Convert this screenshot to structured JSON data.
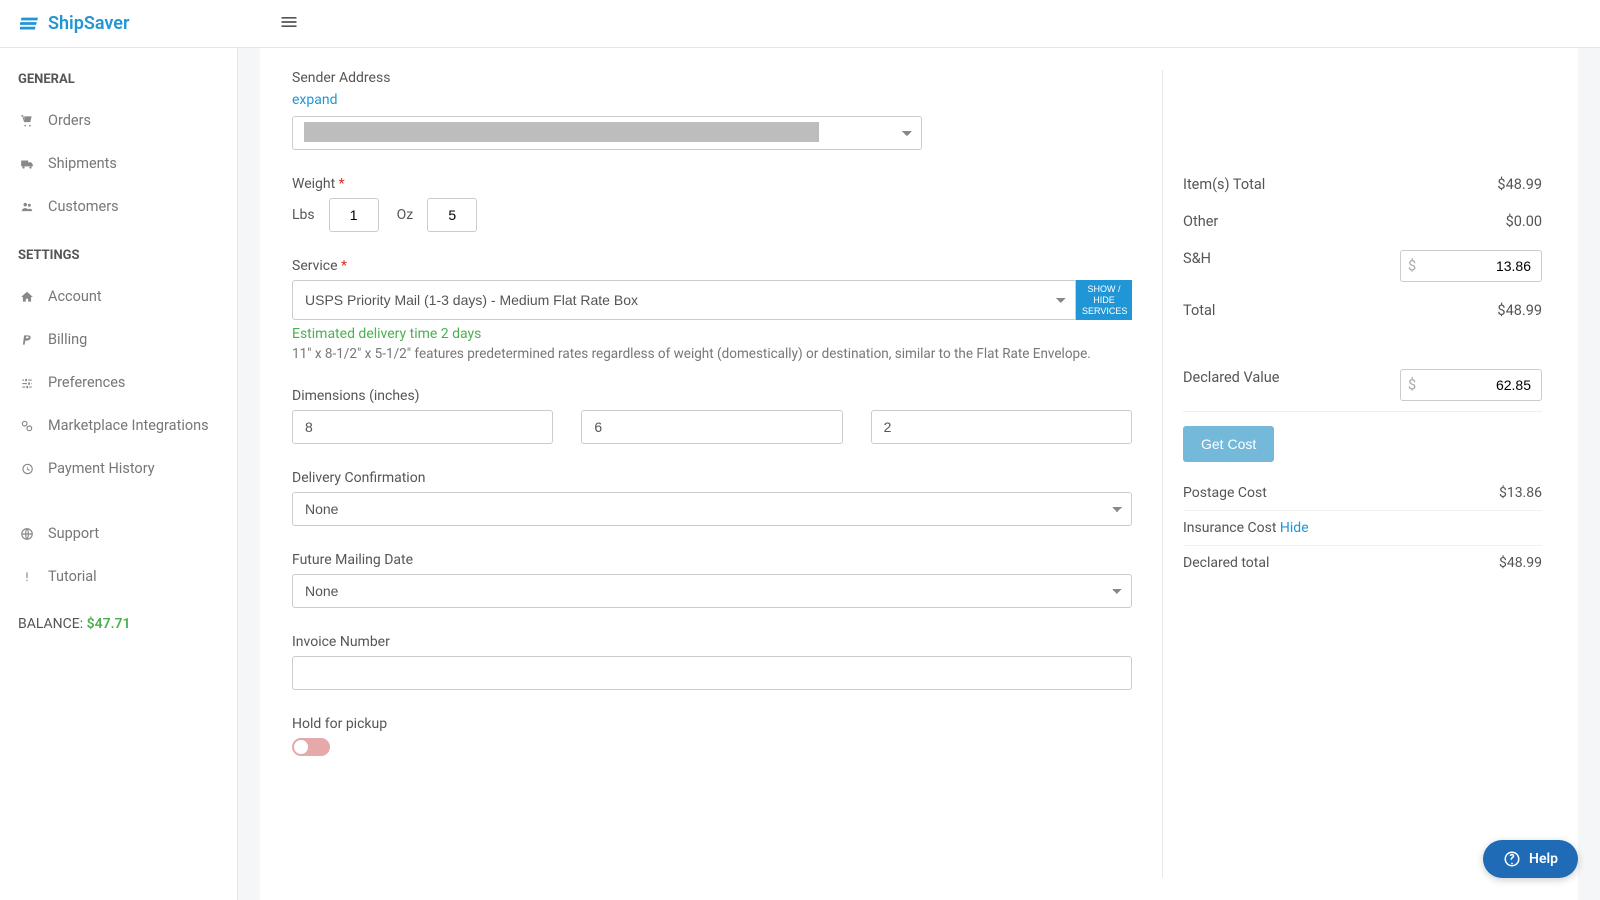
{
  "brand": "ShipSaver",
  "sidebar": {
    "section1": "GENERAL",
    "section2": "SETTINGS",
    "orders": "Orders",
    "shipments": "Shipments",
    "customers": "Customers",
    "account": "Account",
    "billing": "Billing",
    "preferences": "Preferences",
    "marketplace": "Marketplace Integrations",
    "paymentHistory": "Payment History",
    "support": "Support",
    "tutorial": "Tutorial",
    "balanceLabel": "BALANCE: ",
    "balanceAmount": "$47.71"
  },
  "form": {
    "senderLabel": "Sender Address",
    "expandLink": "expand",
    "weightLabel": "Weight ",
    "lbsLabel": "Lbs",
    "ozLabel": "Oz",
    "lbsValue": "1",
    "ozValue": "5",
    "serviceLabel": "Service ",
    "serviceValue": "USPS Priority Mail (1-3 days) - Medium Flat Rate Box",
    "showHideBtn": "SHOW / HIDE SERVICES",
    "deliveryEst": "Estimated delivery time 2 days",
    "serviceDesc": "11\" x 8-1/2\" x 5-1/2\" features predetermined rates regardless of weight (domestically) or destination, similar to the Flat Rate Envelope.",
    "dimensionsLabel": "Dimensions (inches)",
    "dimL": "8",
    "dimW": "6",
    "dimH": "2",
    "deliveryConfLabel": "Delivery Confirmation",
    "deliveryConfValue": "None",
    "futureMailLabel": "Future Mailing Date",
    "futureMailValue": "None",
    "invoiceLabel": "Invoice Number",
    "invoiceValue": "",
    "holdLabel": "Hold for pickup"
  },
  "summary": {
    "itemsTotalLabel": "Item(s) Total",
    "itemsTotal": "$48.99",
    "otherLabel": "Other",
    "other": "$0.00",
    "shLabel": "S&H",
    "shValue": "13.86",
    "totalLabel": "Total",
    "total": "$48.99",
    "declaredLabel": "Declared Value",
    "declaredValue": "62.85",
    "getCostBtn": "Get Cost",
    "postageCostLabel": "Postage Cost",
    "postageCost": "$13.86",
    "insuranceCostLabel": "Insurance Cost ",
    "hideLink": "Hide",
    "declaredTotalLabel": "Declared total",
    "declaredTotal": "$48.99"
  },
  "help": "Help"
}
